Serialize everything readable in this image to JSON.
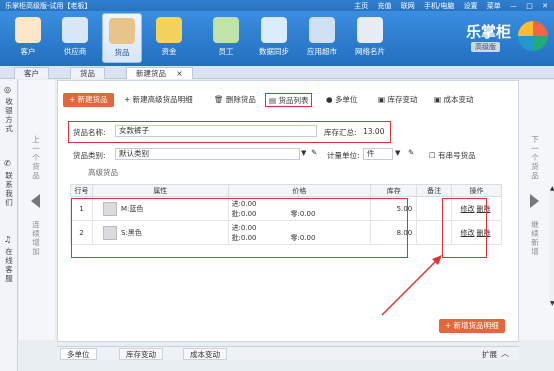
{
  "window": {
    "title": "乐掌柜高级版-试用【老板】",
    "right_items": [
      "主页",
      "充值",
      "联网",
      "手机/电脑",
      "设置",
      "菜单",
      "—",
      "□",
      "✕"
    ]
  },
  "toolbar": {
    "items": [
      {
        "label": "客户",
        "icon": "customer-icon"
      },
      {
        "label": "供应商",
        "icon": "supplier-icon"
      },
      {
        "label": "货品",
        "icon": "goods-icon"
      },
      {
        "label": "资金",
        "icon": "money-icon"
      },
      {
        "label": "员工",
        "icon": "staff-icon"
      },
      {
        "label": "数据同步",
        "icon": "sync-icon"
      },
      {
        "label": "应用超市",
        "icon": "app-store-icon"
      },
      {
        "label": "网络名片",
        "icon": "card-icon"
      }
    ],
    "brand_name": "乐掌柜",
    "brand_edition": "高级版"
  },
  "tabs": [
    "客户",
    "货品",
    "新建货品"
  ],
  "left_sidebar": [
    "收银方式",
    "联系我们",
    "在线客服"
  ],
  "nav": {
    "prev": "上一个货品",
    "next": "下一个货品",
    "save_prev": "连续增加",
    "save_next": "继续新增"
  },
  "actions": {
    "new_goods": "+ 新建货品",
    "new_advanced": "新建高级货品明细",
    "delete_goods": "删除货品",
    "goods_list": "货品列表",
    "multi_unit": "多单位",
    "stock_change": "库存变动",
    "cost_change": "成本变动"
  },
  "form": {
    "name_label": "货品名称:",
    "name_value": "女款裤子",
    "stock_label": "库存汇总:",
    "stock_value": "13.00",
    "category_label": "货品类别:",
    "category_value": "默认类别",
    "unit_label": "计量单位:",
    "unit_value": "件",
    "serial_label": "有串号货品",
    "advanced_label": "高级货品"
  },
  "table": {
    "headers": [
      "行号",
      "属性",
      "价格",
      "库存",
      "备注",
      "操作"
    ],
    "rows": [
      {
        "no": "1",
        "attr": "M:蓝色",
        "in": "进:0.00",
        "wholesale": "批:0.00",
        "retail": "零:0.00",
        "stock": "5.00",
        "op_edit": "修改",
        "op_delete": "删除"
      },
      {
        "no": "2",
        "attr": "S:黑色",
        "in": "进:0.00",
        "wholesale": "批:0.00",
        "retail": "零:0.00",
        "stock": "8.00",
        "op_edit": "修改",
        "op_delete": "删除"
      }
    ]
  },
  "add_detail_button": "+ 新增货品明细",
  "bottom_tabs": [
    "多单位",
    "库存变动",
    "成本变动"
  ],
  "bottom_right": "扩展",
  "colors": {
    "accent": "#2a78c8",
    "highlight": "#e0303a",
    "button": "#e2673a"
  }
}
